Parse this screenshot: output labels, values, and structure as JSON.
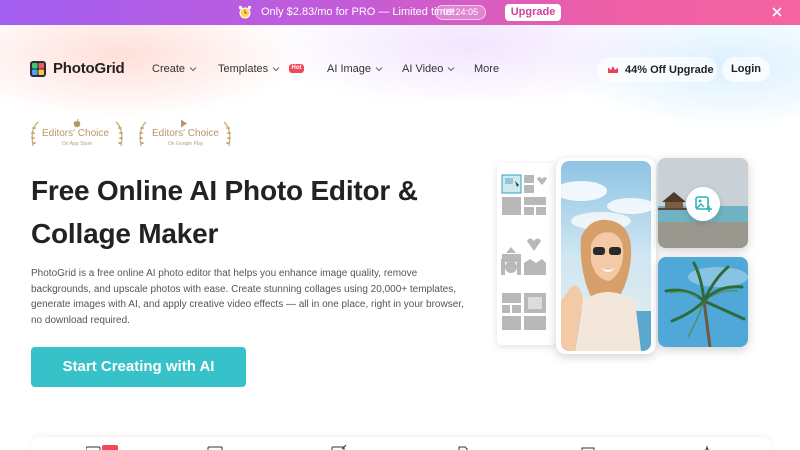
{
  "promo": {
    "text": "Only $2.83/mo for PRO — Limited time!",
    "timer": "09:24:05",
    "button": "Upgrade",
    "icons": [
      "alarm-clock-icon",
      "close-icon"
    ],
    "colors": {
      "gradient_start": "#a15ef0",
      "gradient_end": "#f464a0"
    }
  },
  "nav": {
    "logo_text": "PhotoGrid",
    "items": [
      {
        "label": "Create",
        "has_dropdown": true
      },
      {
        "label": "Templates",
        "has_dropdown": true,
        "badge": "Hot"
      },
      {
        "label": "AI Image",
        "has_dropdown": true
      },
      {
        "label": "AI Video",
        "has_dropdown": true
      },
      {
        "label": "More",
        "has_dropdown": false
      }
    ],
    "upgrade_label": "44% Off Upgrade",
    "login_label": "Login"
  },
  "awards": [
    {
      "title": "Editors' Choice",
      "subtitle": "On App Store",
      "icon": "apple-icon"
    },
    {
      "title": "Editors' Choice",
      "subtitle": "On Google Play",
      "icon": "google-play-icon"
    }
  ],
  "hero": {
    "title_line1": "Free Online AI Photo Editor &",
    "title_line2": "Collage Maker",
    "description": "PhotoGrid is a free online AI photo editor that helps you enhance image quality, remove backgrounds, and upscale photos with ease. Create stunning collages using 20,000+ templates, generate images with AI, and apply creative video effects — all in one place, right in your browser, no download required.",
    "cta_label": "Start Creating with AI",
    "cta_color": "#37c2c9"
  }
}
